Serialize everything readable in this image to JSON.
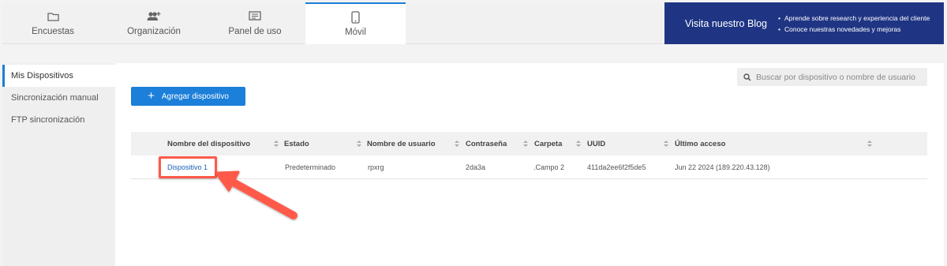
{
  "tabs": [
    {
      "label": "Encuestas",
      "icon": "folder-icon"
    },
    {
      "label": "Organización",
      "icon": "users-add-icon"
    },
    {
      "label": "Panel de uso",
      "icon": "dashboard-icon"
    },
    {
      "label": "Móvil",
      "icon": "mobile-icon",
      "active": true
    }
  ],
  "blog": {
    "title": "Visita nuestro Blog",
    "bullets": [
      "Aprende sobre research y experiencia del cliente",
      "Conoce nuestras novedades y mejoras"
    ]
  },
  "sidebar": {
    "items": [
      {
        "label": "Mis Dispositivos",
        "active": true
      },
      {
        "label": "Sincronización manual"
      },
      {
        "label": "FTP sincronización"
      }
    ]
  },
  "toolbar": {
    "add_label": "Agregar dispositivo"
  },
  "search": {
    "placeholder": "Buscar por dispositivo o nombre de usuario"
  },
  "table": {
    "columns": [
      "Nombre del dispositivo",
      "Estado",
      "Nombre de usuario",
      "Contraseña",
      "Carpeta",
      "UUID",
      "Último acceso"
    ],
    "rows": [
      {
        "name": "Dispositivo 1",
        "estado": "Predeterminado",
        "usuario": "rpxrg",
        "password": "2da3a",
        "carpeta": ".Campo 2",
        "uuid": "411da2ee6f2f5de5",
        "acceso": "Jun 22 2024 (189.220.43.128)"
      }
    ]
  },
  "colors": {
    "accent": "#1c7fd9",
    "blog_bg": "#1f3584",
    "annotation": "#ff5a4a"
  }
}
